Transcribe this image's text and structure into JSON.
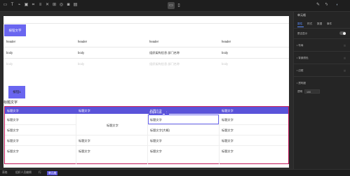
{
  "toolbar": {
    "device_icons": [
      "desktop-icon",
      "mobile-icon"
    ],
    "right_icons": [
      "bug-icon",
      "flash-icon"
    ]
  },
  "canvas": {
    "button1": "按钮文字",
    "table1": {
      "headers": [
        "header",
        "header",
        "header",
        "header"
      ],
      "row1": [
        "body",
        "body",
        "组织架构信息 部门名称",
        "body"
      ],
      "row2": [
        "body",
        "body",
        "组织架构信息 部门名称",
        "body"
      ]
    },
    "button2_label": "按钮1",
    "heading_label": "标题文字",
    "table2": {
      "headers": [
        "标题文字",
        "标题文字",
        "标题文字",
        "标题文字"
      ],
      "row1": [
        "标题文字",
        "标题文字",
        "标题文字",
        "标题文字"
      ],
      "merged": "标题文字",
      "row2_col3": "标题文字(大概)",
      "row2_col1": "标题文字",
      "row2_col4": "标题文字",
      "row3": [
        "标题文字",
        "标题文字",
        "标题文字",
        "标题文字"
      ],
      "row4": [
        "标题文字",
        "标题文字",
        "标题文字",
        "标题文字"
      ],
      "selection_tag": "表格单元格",
      "selection_tag_icon": "⋮"
    }
  },
  "panel": {
    "title": "单元格",
    "tabs": [
      "属性",
      "样式",
      "数据",
      "事件"
    ],
    "active_tab": 0,
    "property_label": "是否显示",
    "sections": [
      "• 布局",
      "• 背景颜色",
      "• 边框",
      "• 透明度"
    ],
    "opacity_label": "透明",
    "opacity_value": "100"
  },
  "bottombar": {
    "crumbs": [
      "表格",
      "组织人员编辑",
      "行",
      "单元格"
    ]
  },
  "colors": {
    "accent": "#5a53d9",
    "selection_border": "#c2185b"
  }
}
